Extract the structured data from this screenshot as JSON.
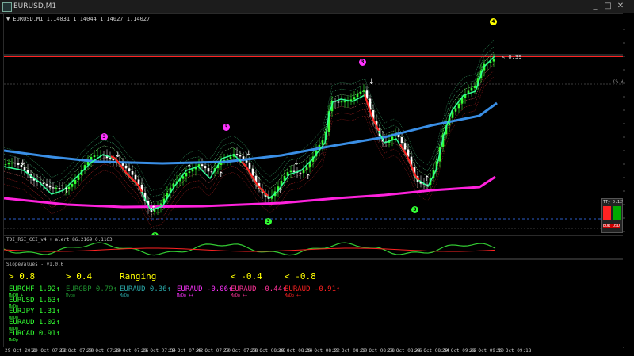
{
  "window": {
    "title": "EURUSD,M1",
    "minimize": "_",
    "maximize": "□",
    "close": "✕"
  },
  "chart": {
    "header": "▼ EURUSD,M1  1.14031 1.14044 1.14027 1.14027",
    "pending_label": "< 0.39",
    "level_label": "(% #%)",
    "rsi_label": "TDI_RSI_CCI_v4 + alert 86.2169 0.1163",
    "minibox_top": "TTy  0.12%",
    "minibox_bottom": "EUR  USD",
    "badges": [
      {
        "text": "3",
        "color": "#ff33ff"
      },
      {
        "text": "3",
        "color": "#ff33ff"
      },
      {
        "text": "3",
        "color": "#ff33ff"
      },
      {
        "text": "3",
        "color": "#33ff33"
      },
      {
        "text": "3",
        "color": "#33ff33"
      },
      {
        "text": "3",
        "color": "#33ff33"
      },
      {
        "text": "4",
        "color": "#ffff00"
      }
    ]
  },
  "panel": {
    "title": "SlopeValues - v1.0.6",
    "thresholds": [
      "> 0.8",
      "> 0.4",
      "Ranging",
      "< -0.4",
      "< -0.8"
    ],
    "col1": [
      {
        "pair": "EURCHF",
        "value": "1.92",
        "arrow": "↑",
        "sub": "MaDH  +",
        "color": "#33ff33"
      },
      {
        "pair": "EURUSD",
        "value": "1.63",
        "arrow": "↑",
        "sub": "MaDp",
        "color": "#33ff33"
      },
      {
        "pair": "EURJPY",
        "value": "1.31",
        "arrow": "↑",
        "sub": "MaDp",
        "color": "#33ff33"
      },
      {
        "pair": "EURAUD",
        "value": "1.02",
        "arrow": "↑",
        "sub": "MaDp",
        "color": "#33ff33"
      },
      {
        "pair": "EURCAD",
        "value": "0.91",
        "arrow": "↑",
        "sub": "MaDp",
        "color": "#33ff33"
      }
    ],
    "col2": {
      "pair": "EURGBP",
      "value": "0.79",
      "arrow": "↑",
      "sub": "Mvpp",
      "color": "#1f8f2f"
    },
    "col3": {
      "pair": "EURAUD",
      "value": "0.36",
      "arrow": "↑",
      "sub": "MaDp",
      "color": "#2aa7a7"
    },
    "col4": {
      "pair": "EURAUD",
      "value": "-0.06",
      "arrow": "↑",
      "sub": "MaDp ++",
      "color": "#ff33ff"
    },
    "col5": {
      "pair": "EURAUD",
      "value": "-0.44",
      "arrow": "↑",
      "sub": "MaDp ++",
      "color": "#ff3399"
    },
    "col6": {
      "pair": "EURAUD",
      "value": "-0.91",
      "arrow": "↑",
      "sub": "MaDp ++",
      "color": "#ff2222"
    }
  },
  "time_axis": [
    "29 Oct 2018",
    "29 Oct 07:02",
    "29 Oct 07:10",
    "29 Oct 07:18",
    "29 Oct 07:26",
    "29 Oct 07:34",
    "29 Oct 07:42",
    "29 Oct 07:50",
    "29 Oct 07:58",
    "29 Oct 08:06",
    "29 Oct 08:14",
    "29 Oct 08:22",
    "29 Oct 08:30",
    "29 Oct 08:38",
    "29 Oct 08:46",
    "29 Oct 08:54",
    "29 Oct 09:02",
    "29 Oct 09:10",
    "29 Oct 09:18"
  ],
  "colors": {
    "blue_ma": "#3a8fe6",
    "magenta_ma": "#ff22dd",
    "red_line": "#ff2222",
    "bull": "#33ff33",
    "bear": "#ff3333"
  }
}
